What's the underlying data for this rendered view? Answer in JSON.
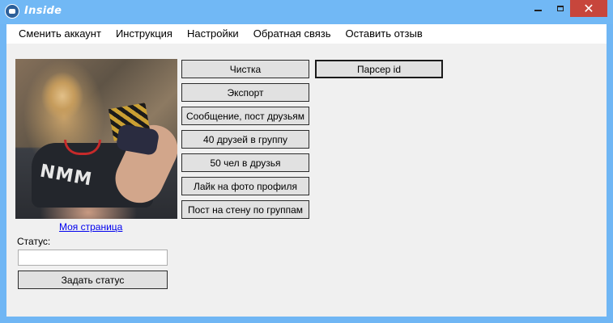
{
  "window": {
    "title": "Inside",
    "controls": {
      "minimize_icon": "minimize-icon",
      "maximize_icon": "maximize-icon",
      "close_icon": "close-icon"
    }
  },
  "menu": {
    "items": [
      "Сменить аккаунт",
      "Инструкция",
      "Настройки",
      "Обратная связь",
      "Оставить отзыв"
    ]
  },
  "profile": {
    "link_text": "Моя страница",
    "status_label": "Статус:",
    "status_value": "",
    "set_status_button": "Задать статус"
  },
  "actions": {
    "cleaning": "Чистка",
    "export": "Экспорт",
    "message_post_friends": "Сообщение, пост друзьям",
    "friends_to_group": "40 друзей в группу",
    "people_to_friends": "50 чел в друзья",
    "like_profile_photo": "Лайк на фото профиля",
    "post_wall_groups": "Пост на стену по группам",
    "parser_id": "Парсер id"
  },
  "colors": {
    "titlebar": "#71b8f5",
    "close": "#c7463c",
    "link": "#0000ee"
  }
}
